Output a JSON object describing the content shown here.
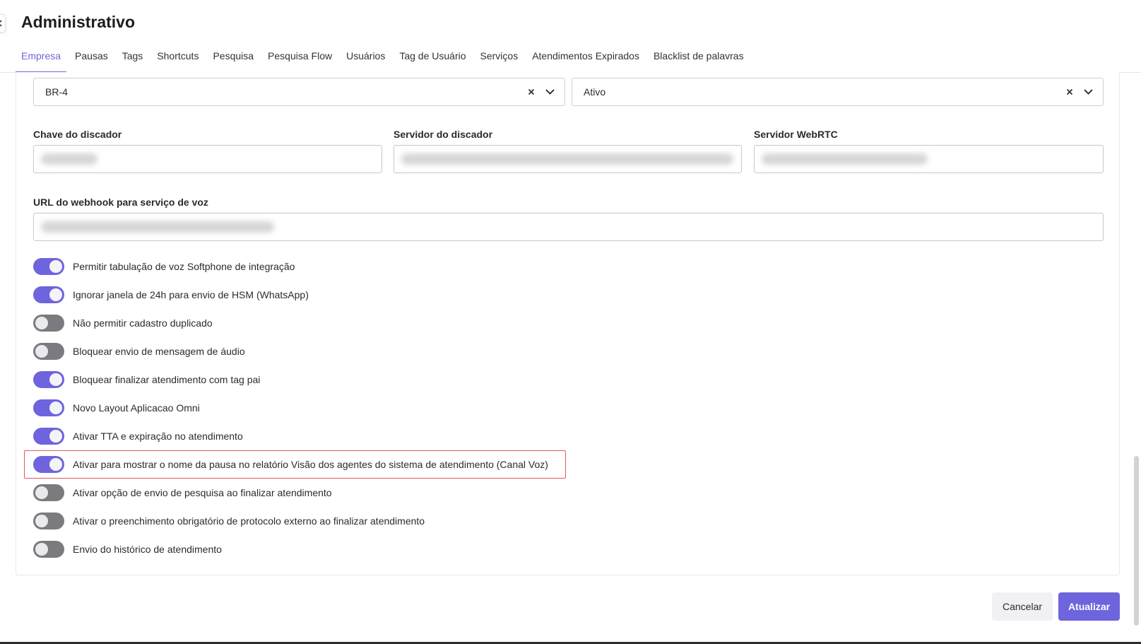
{
  "header": {
    "title": "Administrativo"
  },
  "tabs": [
    {
      "label": "Empresa",
      "active": true
    },
    {
      "label": "Pausas"
    },
    {
      "label": "Tags"
    },
    {
      "label": "Shortcuts"
    },
    {
      "label": "Pesquisa"
    },
    {
      "label": "Pesquisa Flow"
    },
    {
      "label": "Usuários"
    },
    {
      "label": "Tag de Usuário"
    },
    {
      "label": "Serviços"
    },
    {
      "label": "Atendimentos Expirados"
    },
    {
      "label": "Blacklist de palavras"
    }
  ],
  "selects": {
    "region": {
      "value": "BR-4"
    },
    "status": {
      "value": "Ativo"
    }
  },
  "fields": {
    "dialer_key": {
      "label": "Chave do discador"
    },
    "dialer_server": {
      "label": "Servidor do discador"
    },
    "webrtc_server": {
      "label": "Servidor WebRTC"
    },
    "voice_webhook": {
      "label": "URL do webhook para serviço de voz"
    }
  },
  "toggles": [
    {
      "label": "Permitir tabulação de voz Softphone de integração",
      "on": true
    },
    {
      "label": "Ignorar janela de 24h para envio de HSM (WhatsApp)",
      "on": true
    },
    {
      "label": "Não permitir cadastro duplicado",
      "on": false
    },
    {
      "label": "Bloquear envio de mensagem de áudio",
      "on": false
    },
    {
      "label": "Bloquear finalizar atendimento com tag pai",
      "on": true
    },
    {
      "label": "Novo Layout Aplicacao Omni",
      "on": true
    },
    {
      "label": "Ativar TTA e expiração no atendimento",
      "on": true
    },
    {
      "label": "Ativar para mostrar o nome da pausa no relatório Visão dos agentes do sistema de atendimento (Canal Voz)",
      "on": true,
      "highlighted": true
    },
    {
      "label": "Ativar opção de envio de pesquisa ao finalizar atendimento",
      "on": false
    },
    {
      "label": "Ativar o preenchimento obrigatório de protocolo externo ao finalizar atendimento",
      "on": false
    },
    {
      "label": "Envio do histórico de atendimento",
      "on": false
    }
  ],
  "actions": {
    "cancel_label": "Cancelar",
    "update_label": "Atualizar"
  },
  "colors": {
    "accent": "#6e64dd",
    "toggle_off": "#7a7a7f",
    "highlight_border": "#e05a5a"
  }
}
